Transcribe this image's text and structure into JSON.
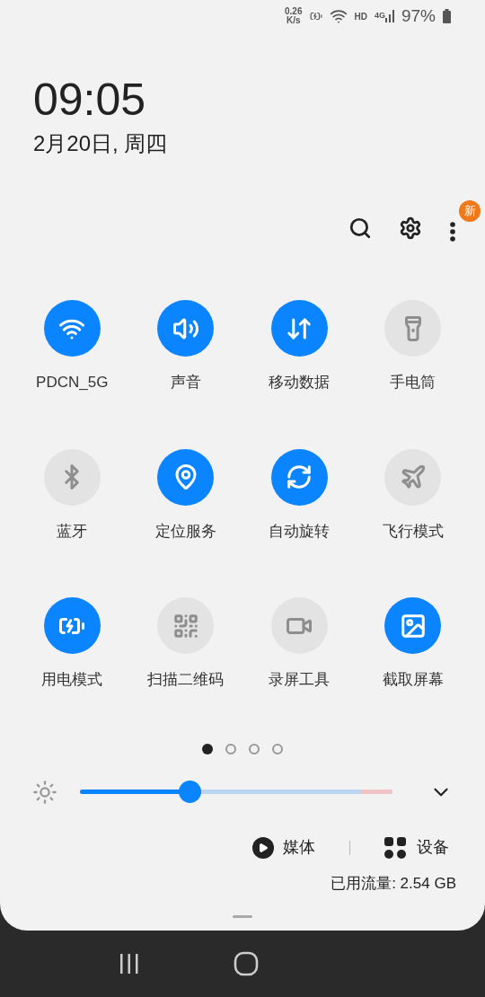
{
  "status_bar": {
    "speed_value": "0.26",
    "speed_unit": "K/s",
    "hd": "HD",
    "network": "4G",
    "battery": "97%"
  },
  "clock": {
    "time": "09:05",
    "date": "2月20日, 周四"
  },
  "toolbar": {
    "badge": "新"
  },
  "tiles": [
    {
      "label": "PDCN_5G",
      "on": true
    },
    {
      "label": "声音",
      "on": true
    },
    {
      "label": "移动数据",
      "on": true
    },
    {
      "label": "手电筒",
      "on": false
    },
    {
      "label": "蓝牙",
      "on": false
    },
    {
      "label": "定位服务",
      "on": true
    },
    {
      "label": "自动旋转",
      "on": true
    },
    {
      "label": "飞行模式",
      "on": false
    },
    {
      "label": "用电模式",
      "on": true
    },
    {
      "label": "扫描二维码",
      "on": false
    },
    {
      "label": "录屏工具",
      "on": false
    },
    {
      "label": "截取屏幕",
      "on": true
    }
  ],
  "pages": [
    {
      "selected": true
    },
    {
      "selected": false
    },
    {
      "selected": false
    },
    {
      "selected": false
    }
  ],
  "brightness": {
    "level": 0.35
  },
  "media": {
    "media_label": "媒体",
    "devices_label": "设备"
  },
  "data_usage": "已用流量: 2.54 GB"
}
